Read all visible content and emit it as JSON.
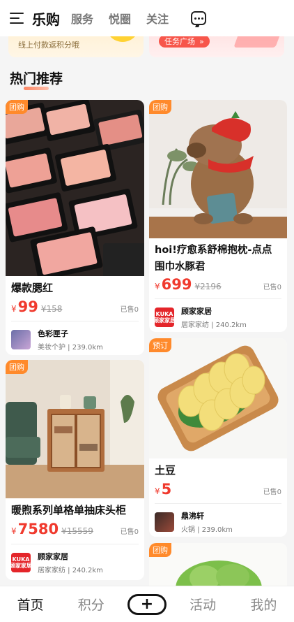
{
  "header": {
    "tabs": [
      {
        "label": "乐购",
        "active": true
      },
      {
        "label": "服务",
        "active": false
      },
      {
        "label": "悦圈",
        "active": false
      },
      {
        "label": "关注",
        "active": false
      }
    ]
  },
  "banner": {
    "left_text": "线上付款返积分哦",
    "right_button": "任务广场",
    "right_button_arrow": "»"
  },
  "section_title": "热门推荐",
  "products": [
    {
      "tag": "团购",
      "title": "爆款腮红",
      "price_symbol": "¥",
      "price": "99",
      "old_price": "¥158",
      "sold": "已售0",
      "shop_name": "色彩匣子",
      "shop_meta": "美妆个护 | 239.0km"
    },
    {
      "tag": "团购",
      "title_line1": "hoi!疗愈系舒棉抱枕-点点",
      "title_line2": "围巾水豚君",
      "price_symbol": "¥",
      "price": "699",
      "old_price": "¥2196",
      "sold": "已售0",
      "shop_name": "顾家家居",
      "shop_meta": "居家家纺 | 240.2km",
      "shop_logo_text": "KUKA\n顾家家居"
    },
    {
      "tag": "团购",
      "title": "暖煦系列单格单抽床头柜",
      "price_symbol": "¥",
      "price": "7580",
      "old_price": "¥15559",
      "sold": "已售0",
      "shop_name": "顾家家居",
      "shop_meta": "居家家纺 | 240.2km",
      "shop_logo_text": "KUKA\n顾家家居"
    },
    {
      "tag": "预订",
      "title": "土豆",
      "price_symbol": "¥",
      "price": "5",
      "sold": "已售0",
      "shop_name": "鼎沸轩",
      "shop_meta": "火锅 | 239.0km"
    },
    {
      "tag": "团购"
    }
  ],
  "bottom_nav": [
    {
      "label": "首页",
      "active": true
    },
    {
      "label": "积分",
      "active": false
    },
    {
      "label": "+",
      "active": false
    },
    {
      "label": "活动",
      "active": false
    },
    {
      "label": "我的",
      "active": false
    }
  ],
  "colors": {
    "accent": "#f03a2e",
    "tag": "#ff8a2b",
    "task_button": "#f7564b",
    "kuka_red": "#e4252a"
  }
}
